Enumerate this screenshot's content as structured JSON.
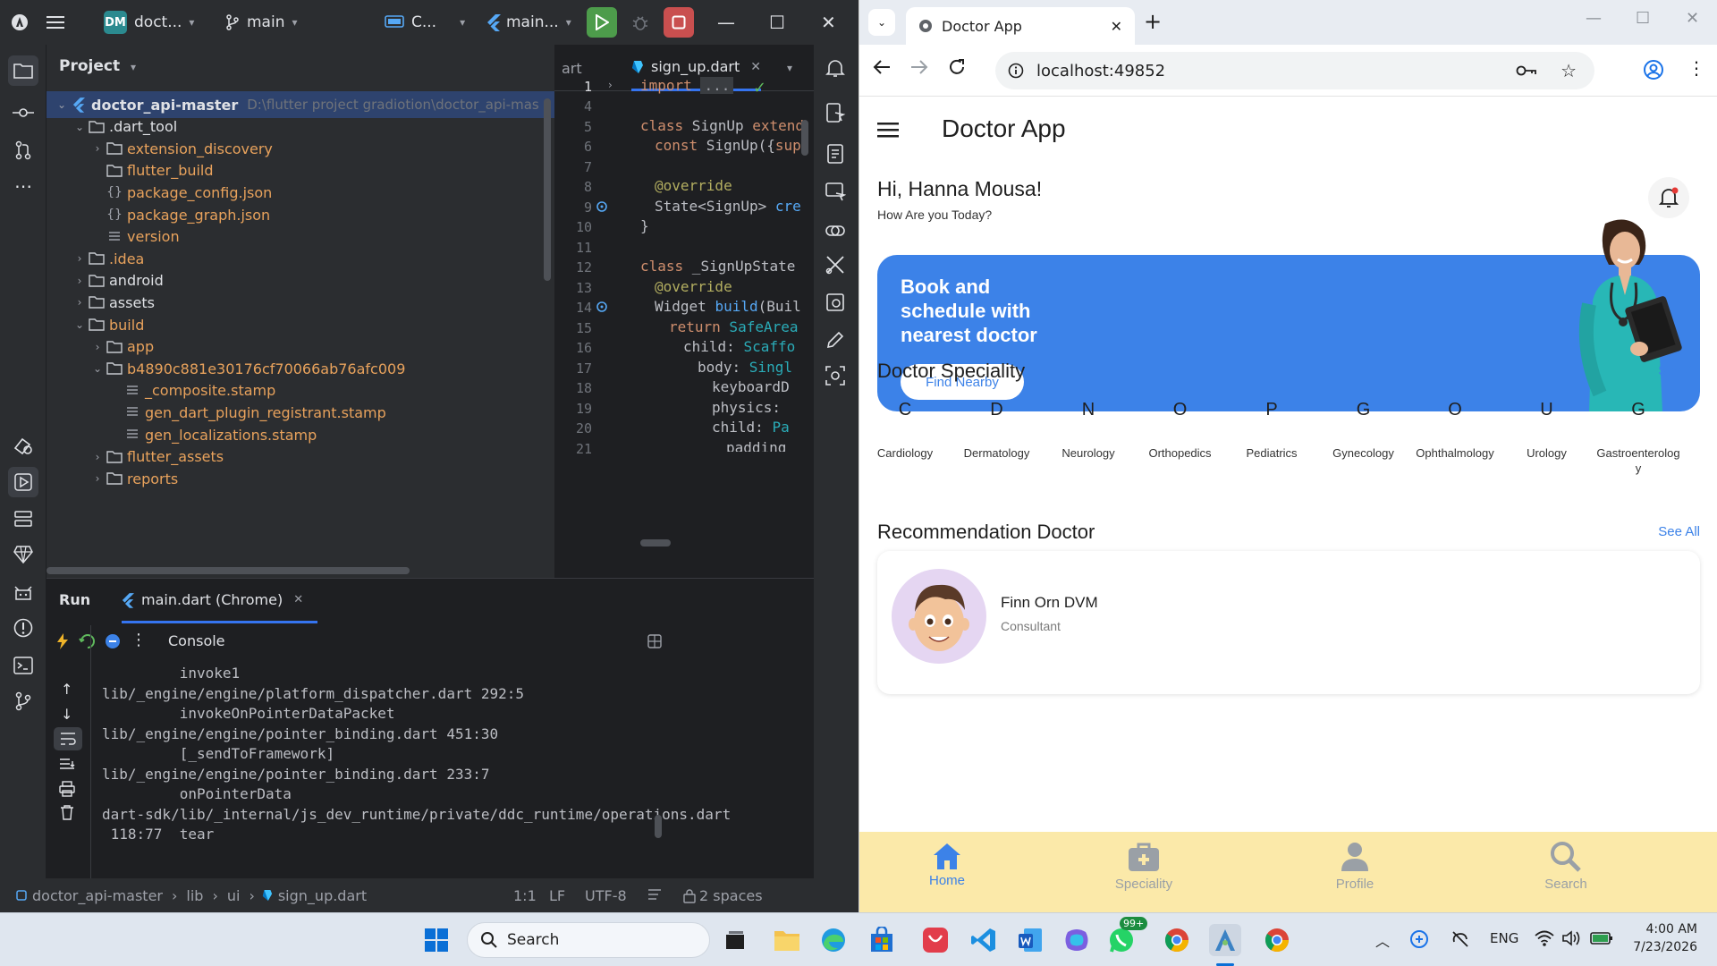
{
  "ide": {
    "titlebar": {
      "project_badge": "DM",
      "project_name": "doct...",
      "branch": "main",
      "run_config": "C...",
      "device": "main...",
      "win_minimize": "—",
      "win_maximize": "☐",
      "win_close": "✕"
    },
    "project_panel": {
      "title": "Project",
      "tree": [
        {
          "label": "doctor_api-master",
          "path": "D:\\flutter project gradiotion\\doctor_api-mas",
          "type": "root"
        },
        {
          "label": ".dart_tool",
          "type": "folder-open"
        },
        {
          "label": "extension_discovery",
          "type": "folder"
        },
        {
          "label": "flutter_build",
          "type": "folder-leaf"
        },
        {
          "label": "package_config.json",
          "type": "json"
        },
        {
          "label": "package_graph.json",
          "type": "json"
        },
        {
          "label": "version",
          "type": "text"
        },
        {
          "label": ".idea",
          "type": "folder"
        },
        {
          "label": "android",
          "type": "folder"
        },
        {
          "label": "assets",
          "type": "folder"
        },
        {
          "label": "build",
          "type": "folder-open"
        },
        {
          "label": "app",
          "type": "folder"
        },
        {
          "label": "b4890c881e30176cf70066ab76afc009",
          "type": "folder-open"
        },
        {
          "label": "_composite.stamp",
          "type": "text"
        },
        {
          "label": "gen_dart_plugin_registrant.stamp",
          "type": "text"
        },
        {
          "label": "gen_localizations.stamp",
          "type": "text"
        },
        {
          "label": "flutter_assets",
          "type": "folder"
        },
        {
          "label": "reports",
          "type": "folder"
        }
      ]
    },
    "editor": {
      "prev_tab": "art",
      "active_tab": "sign_up.dart",
      "line_numbers": [
        "1",
        "4",
        "5",
        "6",
        "7",
        "8",
        "9",
        "10",
        "11",
        "12",
        "13",
        "14",
        "15",
        "16",
        "17",
        "18",
        "19",
        "20",
        "21"
      ],
      "code": {
        "l1_kw": "import",
        "l1_fold": "...",
        "l5_kw": "class",
        "l5_rest": " SignUp ",
        "l5_kw2": "extend",
        "l6_kw": "const",
        "l6_rest": " SignUp({",
        "l6_kw2": "sup",
        "l8": "@override",
        "l9_rest": "State<SignUp> ",
        "l9_fn": "cre",
        "l10": "}",
        "l12_kw": "class",
        "l12_rest": " _SignUpState",
        "l13": "@override",
        "l14_rest": "Widget ",
        "l14_fn": "build",
        "l14_rest2": "(Buil",
        "l15_kw": "return",
        "l15_rest": " SafeArea",
        "l16_rest": "child: ",
        "l16_fn": "Scaffo",
        "l17_rest": "body: ",
        "l17_fn": "Singl",
        "l18": "keyboardD",
        "l19": "physics:",
        "l20_rest": "child: ",
        "l20_fn": "Pa",
        "l21": "padding"
      }
    },
    "run_panel": {
      "tab_run": "Run",
      "tab_config": "main.dart (Chrome)",
      "console_label": "Console",
      "lines": [
        "         invoke1",
        "lib/_engine/engine/platform_dispatcher.dart 292:5",
        "         invokeOnPointerDataPacket",
        "lib/_engine/engine/pointer_binding.dart 451:30",
        "         [_sendToFramework]",
        "lib/_engine/engine/pointer_binding.dart 233:7",
        "         onPointerData",
        "dart-sdk/lib/_internal/js_dev_runtime/private/ddc_runtime/operations.dart",
        " 118:77  tear"
      ]
    },
    "status_bar": {
      "crumbs": [
        "doctor_api-master",
        "lib",
        "ui",
        "sign_up.dart"
      ],
      "position": "1:1",
      "line_ending": "LF",
      "encoding": "UTF-8",
      "indent": "2 spaces"
    }
  },
  "browser": {
    "tab_title": "Doctor App",
    "new_tab": "+",
    "url": "localhost:49852",
    "app": {
      "title": "Doctor App",
      "greeting": "Hi, Hanna Mousa!",
      "subtitle": "How Are you Today?",
      "banner_line1": "Book and",
      "banner_line2": "schedule with",
      "banner_line3": "nearest doctor",
      "banner_button": "Find Nearby",
      "speciality_title": "Doctor Speciality",
      "see_all": "See All",
      "specialities": [
        {
          "letter": "C",
          "label": "Cardiology"
        },
        {
          "letter": "D",
          "label": "Dermatology"
        },
        {
          "letter": "N",
          "label": "Neurology"
        },
        {
          "letter": "O",
          "label": "Orthopedics"
        },
        {
          "letter": "P",
          "label": "Pediatrics"
        },
        {
          "letter": "G",
          "label": "Gynecology"
        },
        {
          "letter": "O",
          "label": "Ophthalmology"
        },
        {
          "letter": "U",
          "label": "Urology"
        },
        {
          "letter": "G",
          "label": "Gastroenterology"
        }
      ],
      "recommendation_title": "Recommendation Doctor",
      "doctor_name": "Finn Orn DVM",
      "doctor_role": "Consultant",
      "nav": {
        "home": "Home",
        "speciality": "Speciality",
        "profile": "Profile",
        "search": "Search"
      },
      "accent": "#3c82e8",
      "nav_bg": "#fbe9a9"
    }
  },
  "taskbar": {
    "search_label": "Search",
    "whatsapp_badge": "99+",
    "lang": "ENG",
    "time": "4:00 AM",
    "date": "7/23/2026"
  }
}
